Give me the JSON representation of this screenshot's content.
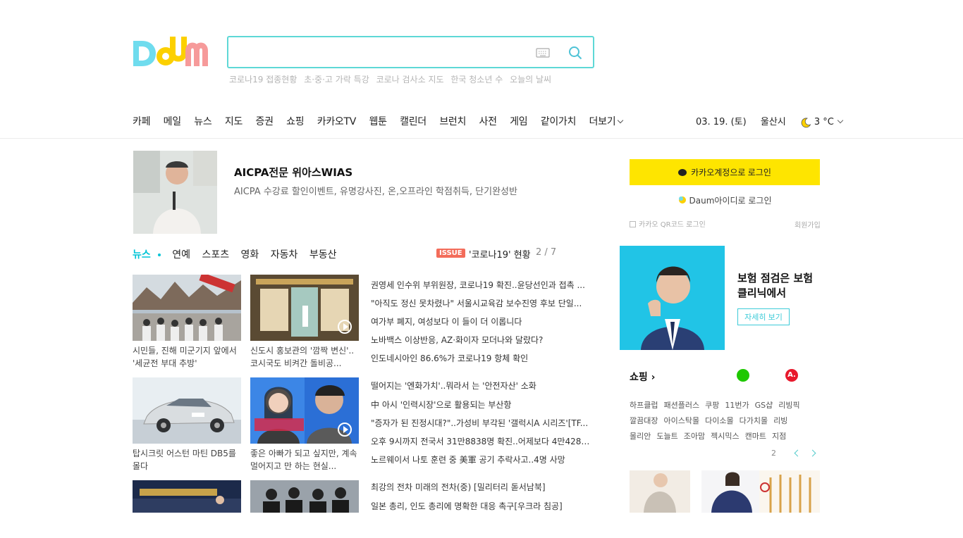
{
  "search": {
    "placeholder": "",
    "suggestions": [
      "코로나19 접종현황",
      "초·중·고 가락 특강",
      "코로나 검사소 지도",
      "한국 청소년 수",
      "오늘의 날씨"
    ]
  },
  "nav": {
    "items": [
      "카페",
      "메일",
      "뉴스",
      "지도",
      "증권",
      "쇼핑",
      "카카오TV",
      "웹툰",
      "캘린더",
      "브런치",
      "사전",
      "게임",
      "같이가치"
    ],
    "more_label": "더보기"
  },
  "status": {
    "date": "03. 19. (토)",
    "location": "울산시",
    "temperature": "3 °C"
  },
  "ad": {
    "title": "AICPA전문 위아스WIAS",
    "description": "AICPA 수강료 할인이벤트, 유명강사진, 온,오프라인 학점취득, 단기완성반"
  },
  "news_tabs": {
    "items": [
      "뉴스",
      "연예",
      "스포츠",
      "영화",
      "자동차",
      "부동산"
    ],
    "issue_badge": "ISSUE",
    "issue_text": "'코로나19' 현황",
    "issue_page": "2 / 7"
  },
  "thumbnails": [
    {
      "caption": "시민들, 진해 미군기지 앞에서 '세균전 부대 추방'"
    },
    {
      "caption": "신도시 홍보관의 '깜짝 변신'.. 코시국도 비켜간 돌비공..."
    },
    {
      "caption": "탑시크릿 어스턴 마틴 DB5를 몰다"
    },
    {
      "caption": "좋은 아빠가 되고 싶지만, 계속 멀어지고 만 하는 현실..."
    },
    {
      "caption": ""
    },
    {
      "caption": ""
    }
  ],
  "headlines": [
    "권영세 인수위 부위원장, 코로나19 확진..윤당선인과 접촉 ...",
    "\"아직도 정신 못차렸나\" 서울시교육감 보수진영 후보 단일...",
    "여가부 폐지, 여성보다 이 들이 더 이롭니다",
    "노바백스 이상반응, AZ·화이자 모더나와 달랐다?",
    "인도네시아인 86.6%가 코로나19 항체 확인",
    "떨어지는 '엔화가치'..뭐라서 는 '안전자산' 소화",
    "中 아시 '인력시장'으로 활용되는 부산항",
    "\"증자가 된 진정시대?\"..가성비 부각된 '갤럭시A 시리즈'[TF...",
    "오후 9시까지 전국서 31만8838명 확진..어제보다 4만4280...",
    "노르웨이서 나토 훈련 중 美軍 공기 추락사고..4명 사망",
    "최강의 전차 미래의 전차(중) [밀리터리 돋서남북]",
    "일본 총리, 인도 총리에 명확한 대응 촉구[우크라 침공]"
  ],
  "login": {
    "kakao_label": "카카오계정으로 로그인",
    "daum_label": "Daum아이디로 로그인",
    "qr_label": "카카오 QR코드 로그인",
    "signup_label": "회원가입"
  },
  "promo": {
    "title": "보험 점검은 보험클리닉에서",
    "button": "자세히 보기"
  },
  "shopping": {
    "title": "쇼핑",
    "row1": [
      "하프클럽",
      "패션플러스",
      "쿠팡",
      "11번가",
      "GS샵",
      "리빙픽"
    ],
    "row2": [
      "깔끔대장",
      "아이스탁몰",
      "다이소몰",
      "다가치몰",
      "리빙"
    ],
    "row3": [
      "몰리안",
      "도늘트",
      "조아맘",
      "젝시믹스",
      "캔마트",
      "지점"
    ],
    "page": "2",
    "logo2_text": "A."
  },
  "colors": {
    "accent": "#00c4d6",
    "kakao_yellow": "#fee500",
    "issue_red": "#f36c5a"
  }
}
